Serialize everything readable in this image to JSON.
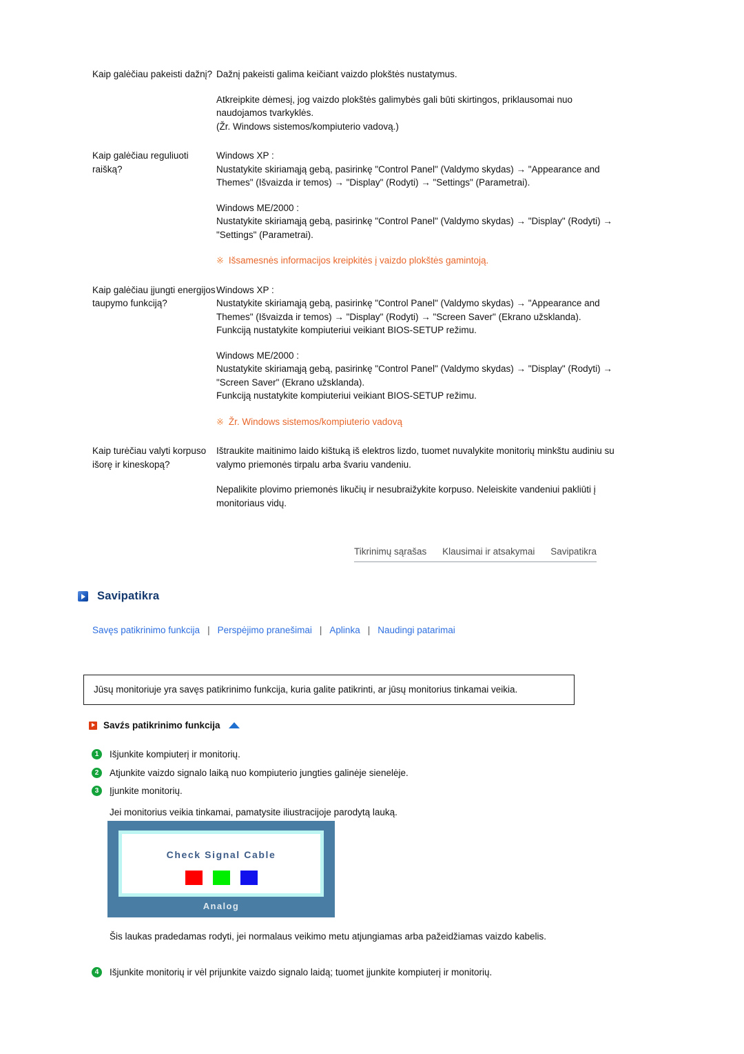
{
  "faq": {
    "rows": [
      {
        "question": "Kaip galėčiau pakeisti dažnį?",
        "answers": [
          "Dažnį pakeisti galima keičiant vaizdo plokštės nustatymus.",
          "Atkreipkite dėmesį, jog vaizdo plokštės galimybės gali būti skirtingos, priklausomai nuo naudojamos tvarkyklės.\n(Žr. Windows sistemos/kompiuterio vadovą.)"
        ],
        "note": null
      },
      {
        "question": "Kaip galėčiau reguliuoti raišką?",
        "answers": [
          "Windows XP :\nNustatykite skiriamąją gebą, pasirinkę \"Control Panel\" (Valdymo skydas) → \"Appearance and Themes\" (Išvaizda ir temos) → \"Display\" (Rodyti) → \"Settings\" (Parametrai).",
          "Windows ME/2000 :\nNustatykite skiriamąją gebą, pasirinkę \"Control Panel\" (Valdymo skydas) → \"Display\" (Rodyti) → \"Settings\" (Parametrai)."
        ],
        "note": "Išsamesnės informacijos kreipkitės į vaizdo plokštės gamintoją.",
        "note_glyph": "※"
      },
      {
        "question": "Kaip galėčiau įjungti energijos taupymo funkciją?",
        "answers": [
          "Windows XP :\nNustatykite skiriamąją gebą, pasirinkę \"Control Panel\" (Valdymo skydas) → \"Appearance and Themes\" (Išvaizda ir temos) → \"Display\" (Rodyti) → \"Screen Saver\" (Ekrano užsklanda).\nFunkciją nustatykite kompiuteriui veikiant BIOS-SETUP režimu.",
          "Windows ME/2000 :\nNustatykite skiriamąją gebą, pasirinkę \"Control Panel\" (Valdymo skydas) → \"Display\" (Rodyti) → \"Screen Saver\" (Ekrano užsklanda).\nFunkciją nustatykite kompiuteriui veikiant BIOS-SETUP režimu."
        ],
        "note": "Žr. Windows sistemos/kompiuterio vadovą",
        "note_glyph": "※"
      },
      {
        "question": "Kaip turėčiau valyti korpuso išorę ir kineskopą?",
        "answers": [
          "Ištraukite maitinimo laido kištuką iš elektros lizdo, tuomet nuvalykite monitorių minkštu audiniu su valymo priemonės tirpalu arba švariu vandeniu.",
          "Nepalikite plovimo priemonės likučių ir nesubraižykite korpuso. Neleiskite vandeniui pakliūti į monitoriaus vidų."
        ],
        "note": null
      }
    ]
  },
  "tabnav": {
    "items": [
      "Tikrinimų sąrašas",
      "Klausimai ir atsakymai",
      "Savipatikra"
    ]
  },
  "section": {
    "icon": "blue-play-icon",
    "title": "Savipatikra"
  },
  "sublinks": {
    "separator": "|",
    "items": [
      "Savęs patikrinimo funkcija",
      "Perspėjimo pranešimai",
      "Aplinka",
      "Naudingi patarimai"
    ]
  },
  "infobox": {
    "text": "Jūsų monitoriuje yra savęs patikrinimo funkcija, kuria galite patikrinti, ar jūsų monitorius tinkamai veikia."
  },
  "subsection": {
    "icon": "orange-play-icon",
    "title": "Savźs patikrinimo funkcija",
    "top_icon": "up-triangle-icon"
  },
  "steps": [
    {
      "num": "1",
      "text": "Išjunkite kompiuterį ir monitorių."
    },
    {
      "num": "2",
      "text": "Atjunkite vaizdo signalo laiką nuo kompiuterio jungties galinėje sienelėje."
    },
    {
      "num": "3",
      "text": "Įjunkite monitorių."
    }
  ],
  "step_note": "Jei monitorius veikia tinkamai, pamatysite iliustracijoje parodytą lauką.",
  "monitor": {
    "screen_title": "Check Signal Cable",
    "label": "Analog",
    "swatches": [
      "#FF0000",
      "#00EE00",
      "#1111EE"
    ],
    "frame_color": "#4a7da3",
    "inner_border_color": "#bdf5f2"
  },
  "tail": {
    "paragraph": "Šis laukas pradedamas rodyti, jei normalaus veikimo metu atjungiamas arba pažeidžiamas vaizdo kabelis.",
    "step": {
      "num": "4",
      "text": "Išjunkite monitorių ir vėl prijunkite vaizdo signalo laidą; tuomet įjunkite kompiuterį ir monitorių."
    }
  }
}
